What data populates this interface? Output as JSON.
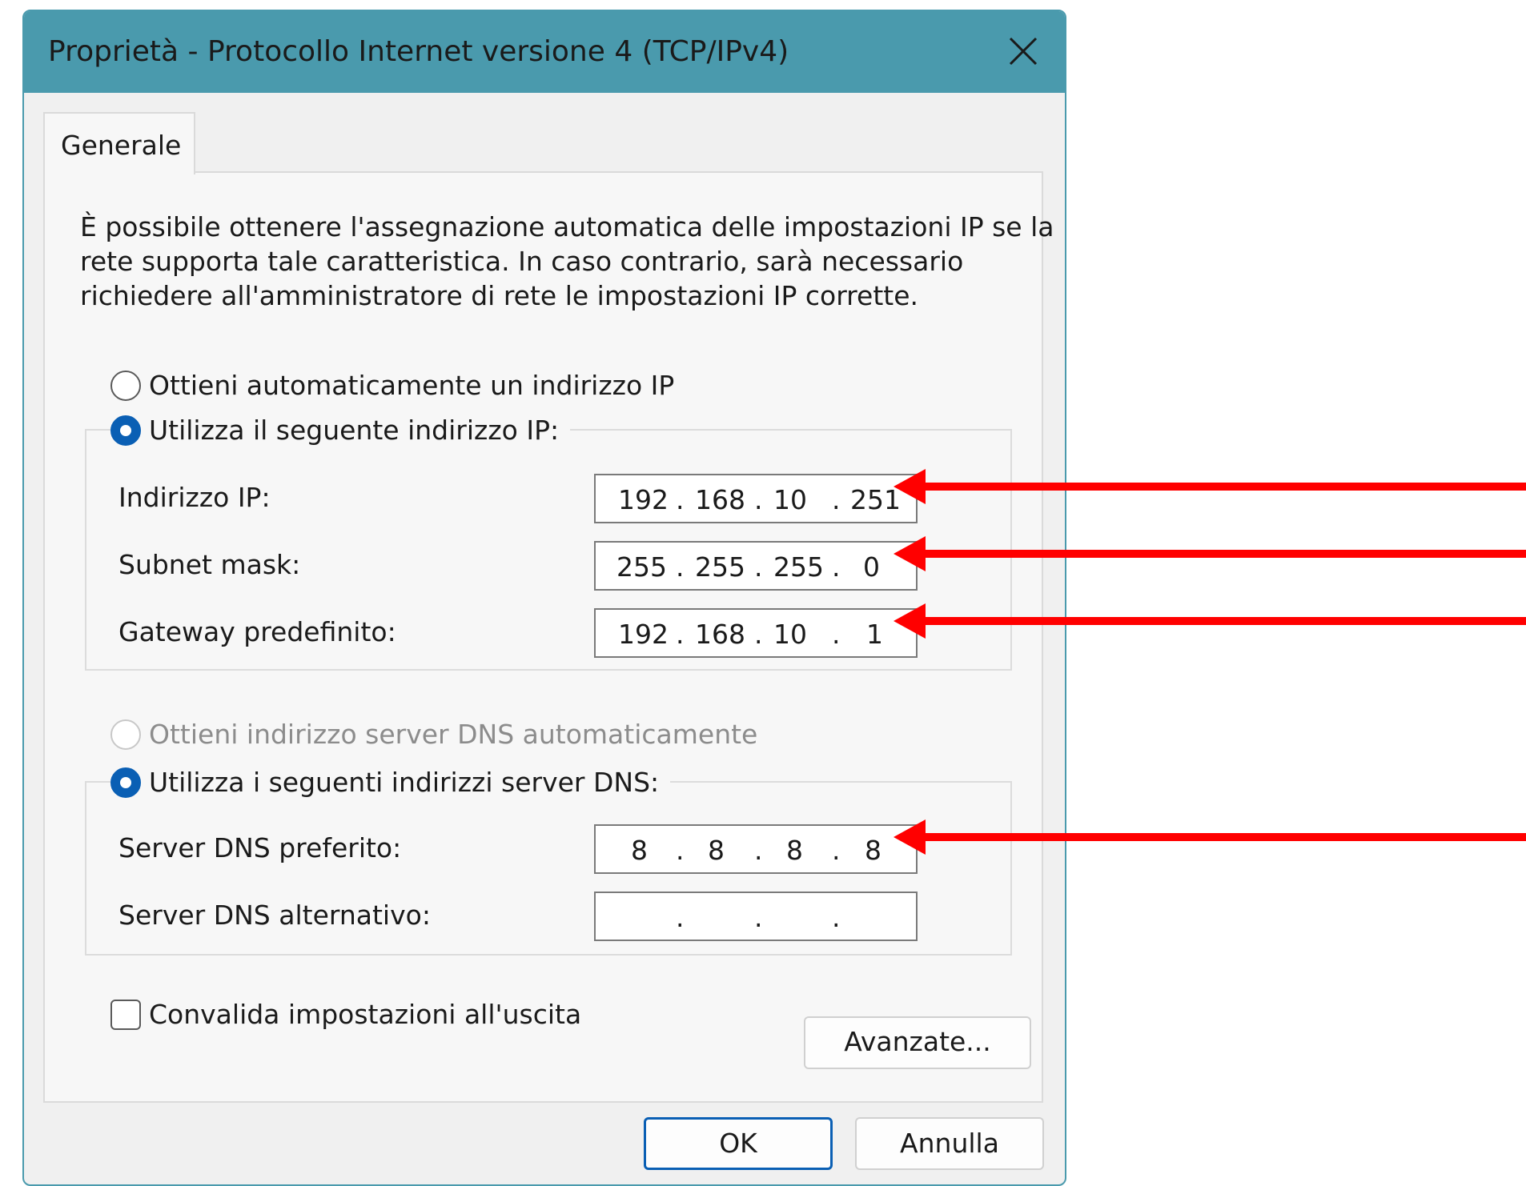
{
  "window": {
    "title": "Proprietà - Protocollo Internet versione 4 (TCP/IPv4)",
    "close_icon": "close-icon"
  },
  "tabs": [
    {
      "label": "Generale",
      "selected": true
    }
  ],
  "description": [
    "È possibile ottenere l'assegnazione automatica delle impostazioni IP se la",
    "rete supporta tale caratteristica. In caso contrario, sarà necessario",
    "richiedere all'amministratore di rete le impostazioni IP corrette."
  ],
  "ip_section": {
    "auto_label": "Ottieni automaticamente un indirizzo IP",
    "auto_checked": false,
    "manual_label": "Utilizza il seguente indirizzo IP:",
    "manual_checked": true,
    "fields": {
      "ip": {
        "label": "Indirizzo IP:",
        "octets": [
          "192",
          "168",
          "10",
          "251"
        ]
      },
      "subnet": {
        "label": "Subnet mask:",
        "octets": [
          "255",
          "255",
          "255",
          "0"
        ]
      },
      "gateway": {
        "label": "Gateway predefinito:",
        "octets": [
          "192",
          "168",
          "10",
          "1"
        ]
      }
    }
  },
  "dns_section": {
    "auto_label": "Ottieni indirizzo server DNS automaticamente",
    "auto_checked": false,
    "auto_disabled": true,
    "manual_label": "Utilizza i seguenti indirizzi server DNS:",
    "manual_checked": true,
    "fields": {
      "preferred": {
        "label": "Server DNS preferito:",
        "octets": [
          "8",
          "8",
          "8",
          "8"
        ]
      },
      "alternate": {
        "label": "Server DNS alternativo:",
        "octets": [
          "",
          "",
          "",
          ""
        ]
      }
    }
  },
  "validate": {
    "label": "Convalida impostazioni all'uscita",
    "checked": false
  },
  "buttons": {
    "advanced": "Avanzate...",
    "ok": "OK",
    "cancel": "Annulla"
  },
  "colors": {
    "titlebar": "#4a9aad",
    "accent": "#0a5fb4",
    "arrow": "#ff0000"
  },
  "dot": "."
}
